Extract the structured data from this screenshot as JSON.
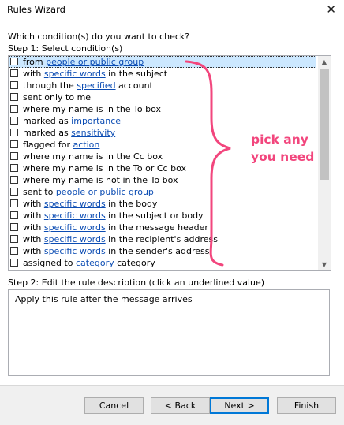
{
  "window": {
    "title": "Rules Wizard",
    "close_glyph": "✕"
  },
  "question": "Which condition(s) do you want to check?",
  "step1_label": "Step 1: Select condition(s)",
  "conditions": [
    {
      "pre": "from ",
      "link": "people or public group",
      "post": "",
      "selected": true
    },
    {
      "pre": "with ",
      "link": "specific words",
      "post": " in the subject"
    },
    {
      "pre": "through the ",
      "link": "specified",
      "post": " account"
    },
    {
      "pre": "sent only to me",
      "link": "",
      "post": ""
    },
    {
      "pre": "where my name is in the To box",
      "link": "",
      "post": ""
    },
    {
      "pre": "marked as ",
      "link": "importance",
      "post": ""
    },
    {
      "pre": "marked as ",
      "link": "sensitivity",
      "post": ""
    },
    {
      "pre": "flagged for ",
      "link": "action",
      "post": ""
    },
    {
      "pre": "where my name is in the Cc box",
      "link": "",
      "post": ""
    },
    {
      "pre": "where my name is in the To or Cc box",
      "link": "",
      "post": ""
    },
    {
      "pre": "where my name is not in the To box",
      "link": "",
      "post": ""
    },
    {
      "pre": "sent to ",
      "link": "people or public group",
      "post": ""
    },
    {
      "pre": "with ",
      "link": "specific words",
      "post": " in the body"
    },
    {
      "pre": "with ",
      "link": "specific words",
      "post": " in the subject or body"
    },
    {
      "pre": "with ",
      "link": "specific words",
      "post": " in the message header"
    },
    {
      "pre": "with ",
      "link": "specific words",
      "post": " in the recipient's address"
    },
    {
      "pre": "with ",
      "link": "specific words",
      "post": " in the sender's address"
    },
    {
      "pre": "assigned to ",
      "link": "category",
      "post": " category"
    }
  ],
  "scrollbar": {
    "up_glyph": "▲",
    "down_glyph": "▼"
  },
  "step2_label": "Step 2: Edit the rule description (click an underlined value)",
  "description": "Apply this rule after the message arrives",
  "buttons": {
    "cancel": "Cancel",
    "back": "< Back",
    "next": "Next >",
    "finish": "Finish"
  },
  "annotation": {
    "line1": "pick any",
    "line2": "you need",
    "color": "#f2467d"
  }
}
